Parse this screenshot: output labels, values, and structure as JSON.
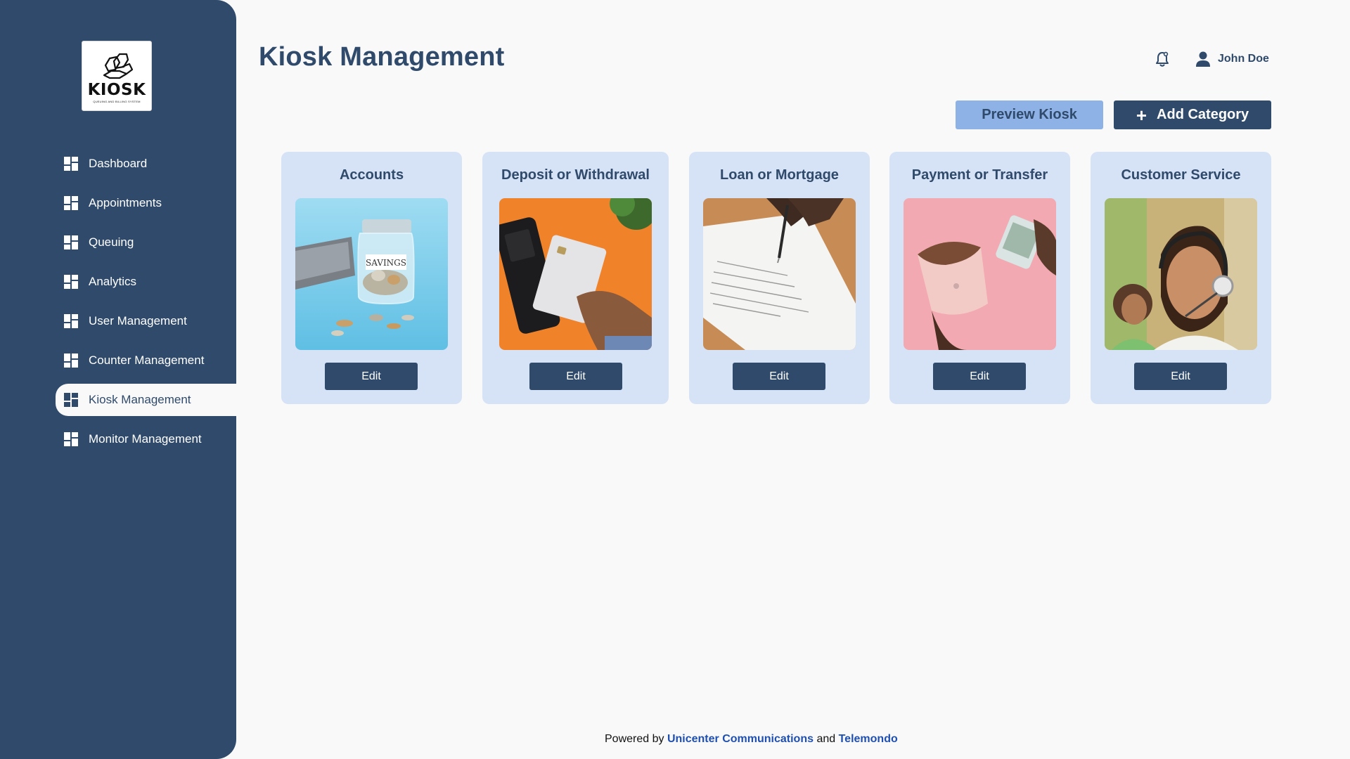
{
  "app": {
    "logo_text": "KIOSK",
    "logo_subtext": "QUEUING AND BILLING SYSTEM"
  },
  "sidebar": {
    "items": [
      {
        "label": "Dashboard",
        "icon": "grid-icon",
        "active": false
      },
      {
        "label": "Appointments",
        "icon": "grid-icon",
        "active": false
      },
      {
        "label": "Queuing",
        "icon": "grid-icon",
        "active": false
      },
      {
        "label": "Analytics",
        "icon": "grid-icon",
        "active": false
      },
      {
        "label": "User Management",
        "icon": "grid-icon",
        "active": false
      },
      {
        "label": "Counter Management",
        "icon": "grid-icon",
        "active": false
      },
      {
        "label": "Kiosk Management",
        "icon": "grid-icon",
        "active": true
      },
      {
        "label": "Monitor Management",
        "icon": "grid-icon",
        "active": false
      }
    ]
  },
  "header": {
    "title": "Kiosk Management",
    "notification_icon": "bell-icon",
    "user_name": "John Doe",
    "user_icon": "user-icon"
  },
  "toolbar": {
    "preview_label": "Preview Kiosk",
    "add_label": "Add Category",
    "add_icon": "plus-icon"
  },
  "categories": [
    {
      "title": "Accounts",
      "image": "savings-jar-photo",
      "edit_label": "Edit"
    },
    {
      "title": "Deposit or Withdrawal",
      "image": "card-terminal-photo",
      "edit_label": "Edit"
    },
    {
      "title": "Loan or Mortgage",
      "image": "signing-document-photo",
      "edit_label": "Edit"
    },
    {
      "title": "Payment or Transfer",
      "image": "wallet-cash-photo",
      "edit_label": "Edit"
    },
    {
      "title": "Customer Service",
      "image": "call-center-agent-photo",
      "edit_label": "Edit"
    }
  ],
  "footer": {
    "prefix": "Powered by",
    "company1": "Unicenter Communications",
    "joiner": "and",
    "company2": "Telemondo"
  },
  "colors": {
    "sidebar": "#2f4a6b",
    "card_bg": "#d6e2f5",
    "primary": "#2f4a6b",
    "secondary_button": "#8fb2e6",
    "link": "#1f4fb0",
    "background": "#f9f9f9"
  }
}
